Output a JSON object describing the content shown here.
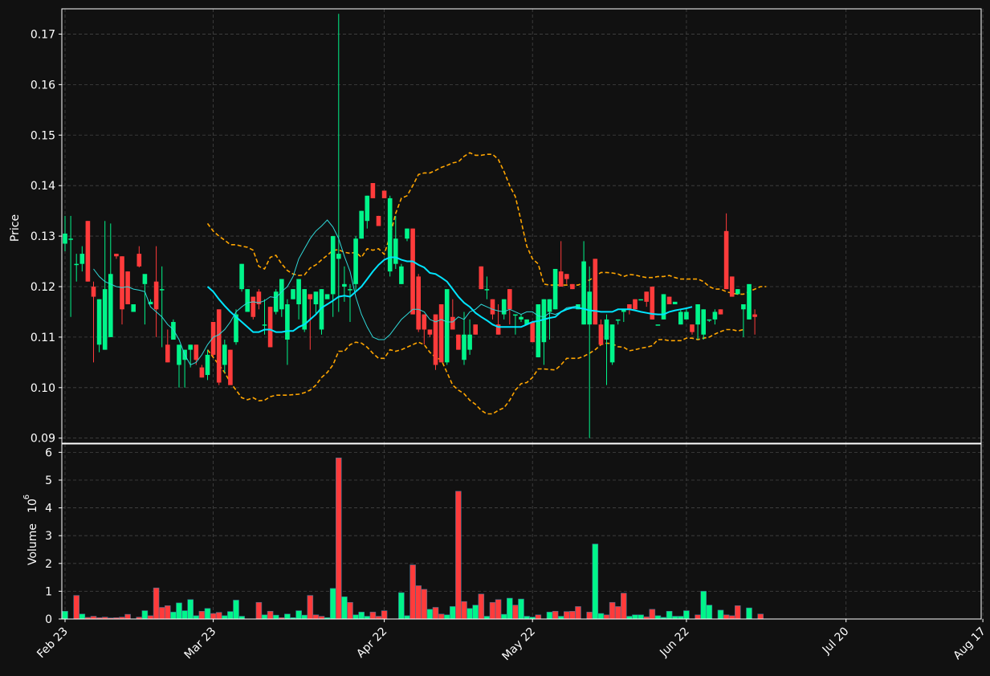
{
  "colors": {
    "background": "#111111",
    "up": "#00f58a",
    "down": "#ff3b3b",
    "ma_fast": "#2fd8d8",
    "ma_slow": "#00e5ff",
    "band": "#ffa500",
    "grid": "#444444",
    "frame": "#ffffff"
  },
  "price_panel": {
    "ylabel": "Price",
    "ticks": [
      "0.09",
      "0.10",
      "0.11",
      "0.12",
      "0.13",
      "0.14",
      "0.15",
      "0.16",
      "0.17"
    ]
  },
  "volume_panel": {
    "ylabel": "Volume",
    "exponent_label": "10",
    "exponent_power": "6",
    "ticks": [
      "0",
      "1",
      "2",
      "3",
      "4",
      "5",
      "6"
    ]
  },
  "x_ticks": [
    {
      "label": "Feb 23",
      "index": 0
    },
    {
      "label": "Mar 23",
      "index": 26
    },
    {
      "label": "Apr 22",
      "index": 56
    },
    {
      "label": "May 22",
      "index": 82
    },
    {
      "label": "Jun 22",
      "index": 109
    },
    {
      "label": "Jul 20",
      "index": 137
    },
    {
      "label": "Aug 17",
      "index": 161
    }
  ],
  "chart_data": {
    "type": "candlestick",
    "title": "",
    "ylim": [
      0.089,
      0.175
    ],
    "volume_ylim": [
      0,
      6.3
    ],
    "grid": true,
    "ohlc": [
      [
        0.1285,
        0.134,
        0.127,
        0.1305
      ],
      [
        0.1295,
        0.134,
        0.114,
        0.1295
      ],
      [
        0.1245,
        0.1265,
        0.121,
        0.1245
      ],
      [
        0.1245,
        0.128,
        0.123,
        0.1265
      ],
      [
        0.133,
        0.133,
        0.121,
        0.121
      ],
      [
        0.12,
        0.121,
        0.105,
        0.118
      ],
      [
        0.1085,
        0.1175,
        0.107,
        0.1175
      ],
      [
        0.1075,
        0.133,
        0.1075,
        0.1195
      ],
      [
        0.11,
        0.1325,
        0.11,
        0.1225
      ],
      [
        0.1265,
        0.1265,
        0.1255,
        0.126
      ],
      [
        0.126,
        0.126,
        0.1125,
        0.1155
      ],
      [
        0.123,
        0.123,
        0.1165,
        0.1165
      ],
      [
        0.115,
        0.1165,
        0.115,
        0.1165
      ],
      [
        0.1265,
        0.128,
        0.1238,
        0.124
      ],
      [
        0.1205,
        0.1205,
        0.1125,
        0.1225
      ],
      [
        0.1165,
        0.1175,
        0.1165,
        0.117
      ],
      [
        0.121,
        0.128,
        0.11,
        0.1155
      ],
      [
        0.1195,
        0.124,
        0.108,
        0.1195
      ],
      [
        0.1085,
        0.1115,
        0.105,
        0.105
      ],
      [
        0.1095,
        0.1135,
        0.1095,
        0.113
      ],
      [
        0.1045,
        0.1085,
        0.1,
        0.1085
      ],
      [
        0.1055,
        0.1075,
        0.1,
        0.1075
      ],
      [
        0.1075,
        0.1085,
        0.104,
        0.1085
      ],
      [
        0.1085,
        0.1085,
        0.1045,
        0.1055
      ],
      [
        0.104,
        0.1045,
        0.102,
        0.102
      ],
      [
        0.1025,
        0.1075,
        0.1015,
        0.1065
      ],
      [
        0.113,
        0.113,
        0.106,
        0.1065
      ],
      [
        0.1155,
        0.1155,
        0.1005,
        0.101
      ],
      [
        0.1045,
        0.1095,
        0.103,
        0.1085
      ],
      [
        0.1075,
        0.1075,
        0.102,
        0.1005
      ],
      [
        0.109,
        0.1155,
        0.1085,
        0.1145
      ],
      [
        0.1195,
        0.1245,
        0.119,
        0.1245
      ],
      [
        0.115,
        0.1195,
        0.115,
        0.1195
      ],
      [
        0.118,
        0.118,
        0.1135,
        0.114
      ],
      [
        0.119,
        0.1195,
        0.1155,
        0.1165
      ],
      [
        0.1125,
        0.1175,
        0.1105,
        0.1125
      ],
      [
        0.116,
        0.116,
        0.108,
        0.108
      ],
      [
        0.115,
        0.1195,
        0.1145,
        0.119
      ],
      [
        0.1155,
        0.1215,
        0.114,
        0.1215
      ],
      [
        0.1095,
        0.1175,
        0.1045,
        0.1165
      ],
      [
        0.1175,
        0.1195,
        0.1175,
        0.1195
      ],
      [
        0.1165,
        0.1215,
        0.1135,
        0.1215
      ],
      [
        0.1115,
        0.1195,
        0.111,
        0.1195
      ],
      [
        0.1185,
        0.1185,
        0.1075,
        0.1175
      ],
      [
        0.1165,
        0.119,
        0.1145,
        0.119
      ],
      [
        0.1115,
        0.1195,
        0.1105,
        0.1195
      ],
      [
        0.1175,
        0.1175,
        0.1175,
        0.1185
      ],
      [
        0.1185,
        0.13,
        0.114,
        0.13
      ],
      [
        0.1255,
        0.174,
        0.115,
        0.1265
      ],
      [
        0.12,
        0.124,
        0.117,
        0.1205
      ],
      [
        0.1195,
        0.1205,
        0.113,
        0.1195
      ],
      [
        0.1205,
        0.13,
        0.119,
        0.1295
      ],
      [
        0.1295,
        0.135,
        0.1295,
        0.135
      ],
      [
        0.133,
        0.138,
        0.1315,
        0.138
      ],
      [
        0.1405,
        0.1405,
        0.1375,
        0.1375
      ],
      [
        0.134,
        0.134,
        0.132,
        0.132
      ],
      [
        0.139,
        0.139,
        0.1375,
        0.1375
      ],
      [
        0.123,
        0.138,
        0.122,
        0.1375
      ],
      [
        0.1245,
        0.134,
        0.1235,
        0.1295
      ],
      [
        0.1205,
        0.1245,
        0.1205,
        0.124
      ],
      [
        0.1295,
        0.1315,
        0.129,
        0.1315
      ],
      [
        0.1315,
        0.1315,
        0.1145,
        0.1145
      ],
      [
        0.122,
        0.1225,
        0.111,
        0.1115
      ],
      [
        0.1145,
        0.1145,
        0.1085,
        0.1115
      ],
      [
        0.1115,
        0.1115,
        0.11,
        0.1105
      ],
      [
        0.1145,
        0.1145,
        0.1035,
        0.1045
      ],
      [
        0.1165,
        0.1165,
        0.105,
        0.105
      ],
      [
        0.105,
        0.1185,
        0.1045,
        0.1195
      ],
      [
        0.114,
        0.1175,
        0.114,
        0.1115
      ],
      [
        0.1105,
        0.1105,
        0.1075,
        0.1075
      ],
      [
        0.1055,
        0.115,
        0.1045,
        0.1105
      ],
      [
        0.1075,
        0.1135,
        0.1065,
        0.1105
      ],
      [
        0.1125,
        0.1125,
        0.1105,
        0.1105
      ],
      [
        0.124,
        0.124,
        0.1195,
        0.1195
      ],
      [
        0.1195,
        0.122,
        0.1175,
        0.1195
      ],
      [
        0.1175,
        0.1175,
        0.1135,
        0.1145
      ],
      [
        0.1125,
        0.1165,
        0.1105,
        0.1105
      ],
      [
        0.1145,
        0.1175,
        0.1135,
        0.1175
      ],
      [
        0.1195,
        0.1195,
        0.1125,
        0.1155
      ],
      [
        0.1145,
        0.1145,
        0.1105,
        0.1145
      ],
      [
        0.1135,
        0.1145,
        0.113,
        0.114
      ],
      [
        0.1125,
        0.1135,
        0.1125,
        0.1135
      ],
      [
        0.113,
        0.113,
        0.1095,
        0.109
      ],
      [
        0.106,
        0.1165,
        0.106,
        0.1165
      ],
      [
        0.109,
        0.1175,
        0.1045,
        0.1175
      ],
      [
        0.115,
        0.1175,
        0.1095,
        0.1175
      ],
      [
        0.1155,
        0.1235,
        0.1155,
        0.1235
      ],
      [
        0.123,
        0.129,
        0.12,
        0.12
      ],
      [
        0.1225,
        0.1225,
        0.1205,
        0.1215
      ],
      [
        0.1205,
        0.1205,
        0.1195,
        0.1195
      ],
      [
        0.1155,
        0.1165,
        0.1155,
        0.1165
      ],
      [
        0.1125,
        0.129,
        0.1125,
        0.125
      ],
      [
        0.1125,
        0.124,
        0.09,
        0.119
      ],
      [
        0.1255,
        0.1255,
        0.1125,
        0.1125
      ],
      [
        0.1125,
        0.1135,
        0.1085,
        0.1085
      ],
      [
        0.1095,
        0.1145,
        0.1005,
        0.1135
      ],
      [
        0.105,
        0.1125,
        0.1045,
        0.1125
      ],
      [
        0.1135,
        0.1135,
        0.1125,
        0.1135
      ],
      [
        0.115,
        0.115,
        0.113,
        0.1155
      ],
      [
        0.1165,
        0.1165,
        0.1145,
        0.1155
      ],
      [
        0.1175,
        0.1175,
        0.1155,
        0.1155
      ],
      [
        0.1175,
        0.1175,
        0.1175,
        0.1175
      ],
      [
        0.119,
        0.119,
        0.116,
        0.117
      ],
      [
        0.12,
        0.12,
        0.1135,
        0.1135
      ],
      [
        0.1125,
        0.1125,
        0.1125,
        0.1125
      ],
      [
        0.1135,
        0.1185,
        0.1135,
        0.1185
      ],
      [
        0.118,
        0.118,
        0.1165,
        0.1165
      ],
      [
        0.1165,
        0.1165,
        0.1165,
        0.117
      ],
      [
        0.1125,
        0.1155,
        0.1125,
        0.115
      ],
      [
        0.1135,
        0.1155,
        0.1135,
        0.115
      ],
      [
        0.1125,
        0.1125,
        0.1105,
        0.111
      ],
      [
        0.1125,
        0.116,
        0.1095,
        0.1165
      ],
      [
        0.1105,
        0.1155,
        0.1095,
        0.1155
      ],
      [
        0.1135,
        0.1135,
        0.113,
        0.1135
      ],
      [
        0.1135,
        0.1155,
        0.1125,
        0.115
      ],
      [
        0.1155,
        0.1155,
        0.1145,
        0.1145
      ],
      [
        0.131,
        0.1345,
        0.1195,
        0.1195
      ],
      [
        0.122,
        0.122,
        0.118,
        0.118
      ],
      [
        0.1185,
        0.1195,
        0.1185,
        0.1195
      ],
      [
        0.1155,
        0.1165,
        0.11,
        0.1165
      ],
      [
        0.1135,
        0.12,
        0.1135,
        0.1205
      ],
      [
        0.1145,
        0.1155,
        0.1105,
        0.114
      ]
    ],
    "ma_fast": [
      0.1235,
      0.122,
      0.121,
      0.1205,
      0.12,
      0.1198,
      0.12,
      0.1195,
      0.1193,
      0.119,
      0.116,
      0.115,
      0.114,
      0.1125,
      0.1115,
      0.1095,
      0.1065,
      0.1045,
      0.105,
      0.1065,
      0.1085,
      0.11,
      0.1105,
      0.1115,
      0.113,
      0.115,
      0.116,
      0.1168,
      0.117,
      0.1168,
      0.1172,
      0.118,
      0.1178,
      0.119,
      0.12,
      0.122,
      0.1255,
      0.1275,
      0.1295,
      0.131,
      0.132,
      0.1332,
      0.1318,
      0.1295,
      0.126,
      0.123,
      0.118,
      0.1145,
      0.112,
      0.11,
      0.1095,
      0.1095,
      0.1105,
      0.112,
      0.1135,
      0.1145,
      0.1155,
      0.1155,
      0.115,
      0.1135,
      0.113,
      0.1135,
      0.113,
      0.113,
      0.114,
      0.1135,
      0.115,
      0.1155,
      0.1165,
      0.116,
      0.1155,
      0.1152,
      0.115,
      0.1155,
      0.115,
      0.1145,
      0.115,
      0.115,
      0.1142,
      0.114,
      0.1148,
      0.1145,
      0.115,
      0.1158,
      0.116,
      0.1162
    ],
    "ma_fast_start": 5,
    "ma_slow": [
      0.12,
      0.119,
      0.1175,
      0.1162,
      0.115,
      0.114,
      0.113,
      0.112,
      0.111,
      0.111,
      0.1115,
      0.1115,
      0.111,
      0.111,
      0.1112,
      0.1112,
      0.112,
      0.1125,
      0.1135,
      0.1145,
      0.1158,
      0.1165,
      0.1172,
      0.118,
      0.1182,
      0.118,
      0.119,
      0.12,
      0.1215,
      0.123,
      0.1243,
      0.1253,
      0.1258,
      0.1258,
      0.1253,
      0.125,
      0.125,
      0.1243,
      0.1238,
      0.1227,
      0.1225,
      0.1218,
      0.121,
      0.1195,
      0.118,
      0.1168,
      0.116,
      0.1148,
      0.114,
      0.1133,
      0.1125,
      0.112,
      0.112,
      0.112,
      0.112,
      0.112,
      0.1125,
      0.113,
      0.1132,
      0.1135,
      0.1138,
      0.114,
      0.115,
      0.1155,
      0.1158,
      0.1158,
      0.1156,
      0.1153,
      0.1152,
      0.115,
      0.115,
      0.115,
      0.1155,
      0.1155,
      0.1155,
      0.1153,
      0.115,
      0.1148,
      0.1146,
      0.1145,
      0.1145,
      0.115,
      0.1153,
      0.1155,
      0.1157,
      0.116
    ],
    "ma_slow_start": 25,
    "band_upper": [
      0.1325,
      0.131,
      0.13,
      0.1292,
      0.1283,
      0.1283,
      0.128,
      0.1278,
      0.1272,
      0.124,
      0.1235,
      0.1258,
      0.1262,
      0.1245,
      0.1232,
      0.1225,
      0.1222,
      0.1223,
      0.1237,
      0.1243,
      0.1253,
      0.1262,
      0.1272,
      0.1273,
      0.1268,
      0.1266,
      0.1268,
      0.1258,
      0.1275,
      0.1272,
      0.1275,
      0.1264,
      0.13,
      0.1345,
      0.1375,
      0.138,
      0.14,
      0.1422,
      0.1425,
      0.1425,
      0.143,
      0.1436,
      0.144,
      0.1445,
      0.1447,
      0.1458,
      0.1465,
      0.146,
      0.146,
      0.1462,
      0.1462,
      0.1452,
      0.1428,
      0.14,
      0.1378,
      0.133,
      0.128,
      0.1255,
      0.1245,
      0.1205,
      0.1203,
      0.1203,
      0.1203,
      0.1203,
      0.1203,
      0.1203,
      0.1208,
      0.1213,
      0.122,
      0.1228,
      0.1228,
      0.1227,
      0.1225,
      0.122,
      0.1224,
      0.1223,
      0.122,
      0.1218,
      0.1218,
      0.122,
      0.122,
      0.1222,
      0.1218,
      0.1215,
      0.1215,
      0.1215,
      0.1215,
      0.121,
      0.12,
      0.1195,
      0.1195,
      0.119,
      0.1187,
      0.1185,
      0.1185,
      0.119,
      0.1195,
      0.12,
      0.12
    ],
    "band_lower": [
      0.1075,
      0.106,
      0.1045,
      0.103,
      0.101,
      0.0995,
      0.098,
      0.0976,
      0.098,
      0.0974,
      0.0975,
      0.0982,
      0.0985,
      0.0985,
      0.0985,
      0.0986,
      0.0987,
      0.099,
      0.0995,
      0.1005,
      0.102,
      0.103,
      0.1045,
      0.1072,
      0.1072,
      0.1085,
      0.109,
      0.1088,
      0.108,
      0.1068,
      0.1058,
      0.1058,
      0.1075,
      0.1072,
      0.1075,
      0.108,
      0.1085,
      0.109,
      0.1085,
      0.107,
      0.106,
      0.1055,
      0.103,
      0.1005,
      0.0995,
      0.0988,
      0.0975,
      0.0967,
      0.0955,
      0.0948,
      0.0948,
      0.0955,
      0.096,
      0.0975,
      0.0995,
      0.1008,
      0.101,
      0.102,
      0.1037,
      0.1037,
      0.1036,
      0.1035,
      0.1045,
      0.1058,
      0.1058,
      0.1058,
      0.1062,
      0.1068,
      0.1075,
      0.1085,
      0.1088,
      0.1087,
      0.1081,
      0.108,
      0.1073,
      0.1075,
      0.1078,
      0.108,
      0.1083,
      0.1095,
      0.1095,
      0.1093,
      0.1093,
      0.1093,
      0.1098,
      0.1098,
      0.1095,
      0.1098,
      0.11,
      0.1106,
      0.1111,
      0.1115,
      0.1115,
      0.1112,
      0.1115
    ],
    "band_start": 25,
    "volume": [
      0.28,
      0.0,
      0.85,
      0.18,
      0.06,
      0.1,
      0.05,
      0.07,
      0.04,
      0.05,
      0.07,
      0.17,
      0.0,
      0.07,
      0.3,
      0.12,
      1.12,
      0.42,
      0.48,
      0.25,
      0.58,
      0.3,
      0.7,
      0.12,
      0.28,
      0.38,
      0.2,
      0.24,
      0.12,
      0.27,
      0.68,
      0.1,
      0.0,
      0.0,
      0.6,
      0.15,
      0.28,
      0.14,
      0.05,
      0.18,
      0.05,
      0.3,
      0.14,
      0.85,
      0.15,
      0.1,
      0.05,
      1.1,
      5.8,
      0.8,
      0.6,
      0.15,
      0.25,
      0.1,
      0.25,
      0.1,
      0.3,
      0.0,
      0.0,
      0.95,
      0.12,
      1.95,
      1.2,
      1.07,
      0.35,
      0.42,
      0.18,
      0.15,
      0.45,
      4.6,
      0.63,
      0.38,
      0.5,
      0.9,
      0.1,
      0.6,
      0.7,
      0.17,
      0.75,
      0.5,
      0.72,
      0.1,
      0.07,
      0.15,
      0.0,
      0.25,
      0.28,
      0.1,
      0.27,
      0.28,
      0.45,
      0.0,
      0.25,
      2.7,
      0.2,
      0.15,
      0.6,
      0.45,
      0.93,
      0.1,
      0.15,
      0.15,
      0.08,
      0.35,
      0.12,
      0.06,
      0.28,
      0.1,
      0.1,
      0.3,
      0.0,
      0.15,
      1.0,
      0.5,
      0.0,
      0.32,
      0.15,
      0.12,
      0.48,
      0.0,
      0.4,
      0.0,
      0.18
    ],
    "volume_up": [
      1,
      0,
      0,
      1,
      0,
      0,
      0,
      0,
      0,
      0,
      0,
      0,
      0,
      0,
      1,
      0,
      0,
      0,
      0,
      1,
      1,
      1,
      1,
      1,
      0,
      1,
      0,
      0,
      1,
      1,
      1,
      1,
      1,
      1,
      0,
      1,
      0,
      1,
      0,
      1,
      1,
      1,
      1,
      0,
      0,
      0,
      1,
      1,
      0,
      1,
      0,
      1,
      1,
      1,
      0,
      0,
      0,
      1,
      1,
      1,
      1,
      0,
      0,
      0,
      1,
      0,
      0,
      1,
      1,
      0,
      0,
      1,
      1,
      0,
      1,
      0,
      0,
      1,
      1,
      0,
      1,
      1,
      1,
      0,
      1,
      1,
      0,
      1,
      0,
      0,
      0,
      1,
      0,
      1,
      1,
      0,
      0,
      0,
      0,
      1,
      1,
      1,
      0,
      0,
      1,
      1,
      1,
      1,
      1,
      1,
      1,
      0,
      1,
      1,
      1,
      1,
      0,
      0,
      0,
      1,
      1,
      1,
      0
    ]
  }
}
